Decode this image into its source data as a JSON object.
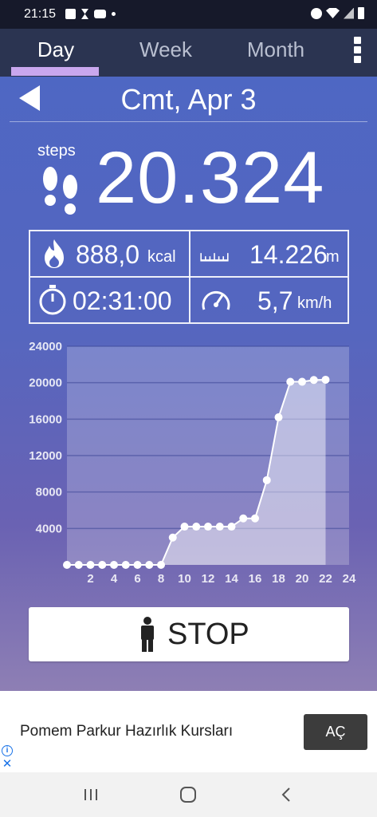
{
  "status_bar": {
    "time": "21:15"
  },
  "tabs": [
    {
      "label": "Day",
      "active": true
    },
    {
      "label": "Week",
      "active": false
    },
    {
      "label": "Month",
      "active": false
    }
  ],
  "header": {
    "date": "Cmt, Apr 3"
  },
  "steps": {
    "label": "steps",
    "value": "20.324"
  },
  "stats": {
    "calories": {
      "value": "888,0",
      "unit": "kcal"
    },
    "distance": {
      "value": "14.226",
      "unit": "m"
    },
    "duration": {
      "value": "02:31:00"
    },
    "speed": {
      "value": "5,7",
      "unit": "km/h"
    }
  },
  "stop_button": {
    "label": "STOP"
  },
  "ad": {
    "text": "Pomem Parkur Hazırlık Kursları",
    "button": "AÇ"
  },
  "colors": {
    "tab_bar": "#2b3451",
    "tab_indicator": "#c9a7ee",
    "background_top": "#4d67c4",
    "background_bottom": "#8e7fb4"
  },
  "chart_data": {
    "type": "area",
    "x": [
      0,
      1,
      2,
      3,
      4,
      5,
      6,
      7,
      8,
      9,
      10,
      11,
      12,
      13,
      14,
      15,
      16,
      17,
      18,
      19,
      20,
      21,
      22
    ],
    "values": [
      0,
      0,
      0,
      0,
      0,
      0,
      0,
      0,
      0,
      3000,
      4200,
      4200,
      4200,
      4200,
      4200,
      5100,
      5100,
      9300,
      16200,
      20100,
      20100,
      20300,
      20324
    ],
    "ylim": [
      0,
      24000
    ],
    "xlim": [
      0,
      24
    ],
    "yticks": [
      "4000",
      "8000",
      "12000",
      "16000",
      "20000",
      "24000"
    ],
    "xticks": [
      "2",
      "4",
      "6",
      "8",
      "10",
      "12",
      "14",
      "16",
      "18",
      "20",
      "22",
      "24"
    ],
    "grid": true
  }
}
